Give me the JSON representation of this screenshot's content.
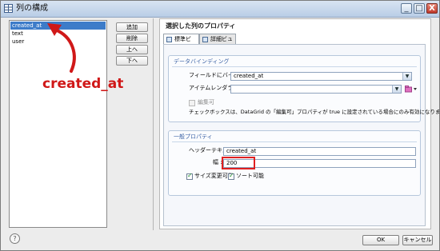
{
  "window": {
    "title": "列の構成",
    "minimize": "_",
    "maximize": "□",
    "close": "X"
  },
  "column_list": {
    "items": [
      {
        "label": "created_at",
        "selected": true
      },
      {
        "label": "text",
        "selected": false
      },
      {
        "label": "user",
        "selected": false
      }
    ]
  },
  "list_buttons": {
    "add": "追加",
    "delete": "削除",
    "up": "上へ",
    "down": "下へ"
  },
  "annotation": {
    "label": "created_at",
    "color": "#d01818"
  },
  "properties": {
    "title": "選択した列のプロパティ",
    "tabs": [
      {
        "label": "標準ビュー",
        "active": true
      },
      {
        "label": "詳細ビュー",
        "active": false
      }
    ],
    "data_binding": {
      "title": "データバインディング",
      "bind_field_label": "フィールドにバインド :",
      "bind_field_value": "created_at",
      "item_renderer_label": "アイテムレンダラー :",
      "item_renderer_value": "",
      "editable_label": "編集可",
      "editable_checked": false,
      "note": "チェックボックスは、DataGrid の「編集可」プロパティが true に設定されている場合にのみ有効になります。"
    },
    "general": {
      "title": "一般プロパティ",
      "header_text_label": "ヘッダーテキスト :",
      "header_text_value": "created_at",
      "width_label": "幅 :",
      "width_value": "200",
      "resizable_label": "サイズ変更可能",
      "resizable_checked": true,
      "sortable_label": "ソート可能",
      "sortable_checked": true
    }
  },
  "footer": {
    "help": "?",
    "ok": "OK",
    "cancel": "キャンセル"
  }
}
